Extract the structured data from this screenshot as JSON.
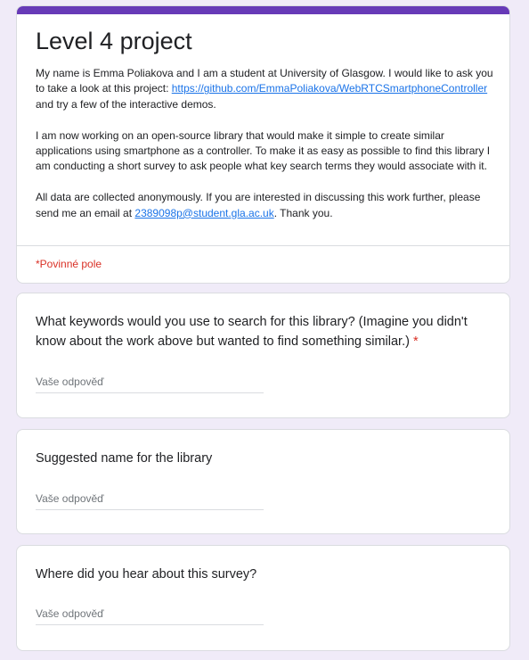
{
  "form": {
    "title": "Level 4 project",
    "description": {
      "p1_before_link": "My name is Emma Poliakova and I am a student at University of Glasgow. I would like to ask you to take a look at this project: ",
      "link_text": "https://github.com/EmmaPoliakova/WebRTCSmartphoneController",
      "p1_after_link": " and try a few of the interactive demos.",
      "p2": "I am now working on an open-source library that would make it simple to create similar applications using smartphone as a controller. To make it as easy as possible to find this library I am conducting a short survey to ask people what key search terms they would associate with it.",
      "p3_before_email": "All data are collected anonymously. If you are interested in discussing this work further, please send me an email at ",
      "email": "2389098p@student.gla.ac.uk",
      "p3_after_email": ". Thank you."
    },
    "required_note": "*Povinné pole"
  },
  "questions": [
    {
      "title": "What keywords would you use to search for this library? (Imagine you didn't know about the work above but wanted to find something similar.)",
      "required_marker": "*",
      "placeholder": "Vaše odpověď"
    },
    {
      "title": "Suggested name for the library",
      "placeholder": "Vaše odpověď"
    },
    {
      "title": "Where did you hear about this survey?",
      "placeholder": "Vaše odpověď"
    }
  ],
  "colors": {
    "accent": "#673ab7",
    "background": "#f0ebf8",
    "required": "#d93025",
    "link": "#1a73e8"
  }
}
